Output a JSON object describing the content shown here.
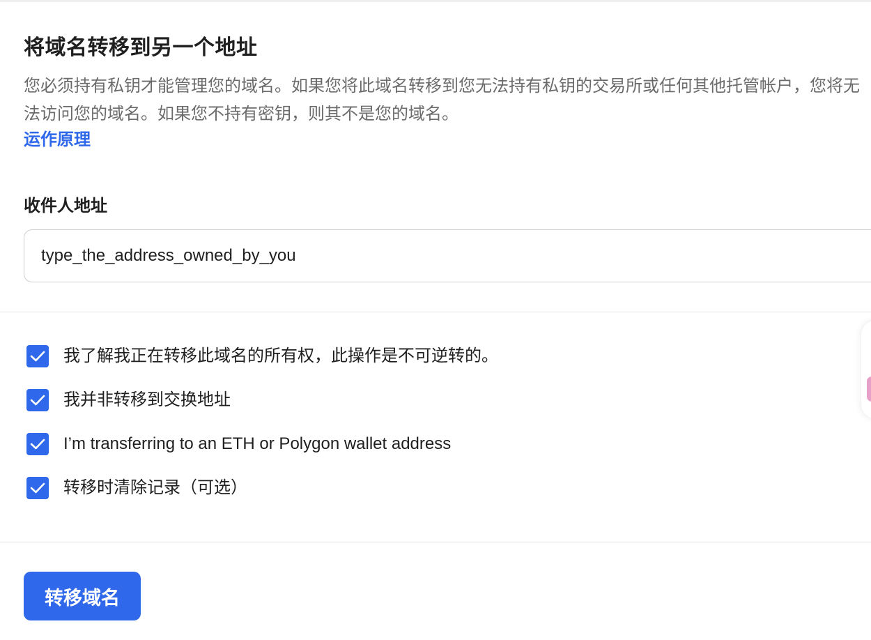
{
  "dialog": {
    "title": "将域名转移到另一个地址",
    "description": "您必须持有私钥才能管理您的域名。如果您将此域名转移到您无法持有私钥的交易所或任何其他托管帐户，您将无法访问您的域名。如果您不持有密钥，则其不是您的域名。",
    "how_it_works_link": "运作原理"
  },
  "recipient": {
    "label": "收件人地址",
    "value": "type_the_address_owned_by_you"
  },
  "checkboxes": [
    {
      "label": "我了解我正在转移此域名的所有权，此操作是不可逆转的。",
      "checked": true
    },
    {
      "label": "我并非转移到交换地址",
      "checked": true
    },
    {
      "label": "I’m transferring to an ETH or Polygon wallet address",
      "checked": true
    },
    {
      "label": "转移时清除记录（可选）",
      "checked": true
    }
  ],
  "actions": {
    "transfer_button": "转移域名"
  },
  "colors": {
    "accent": "#2f68ea",
    "text": "#1f1f1f",
    "muted_text": "#6b6b6b",
    "border": "#cfcfcf"
  },
  "icons": {
    "checkbox_checked": "checkmark-icon"
  }
}
